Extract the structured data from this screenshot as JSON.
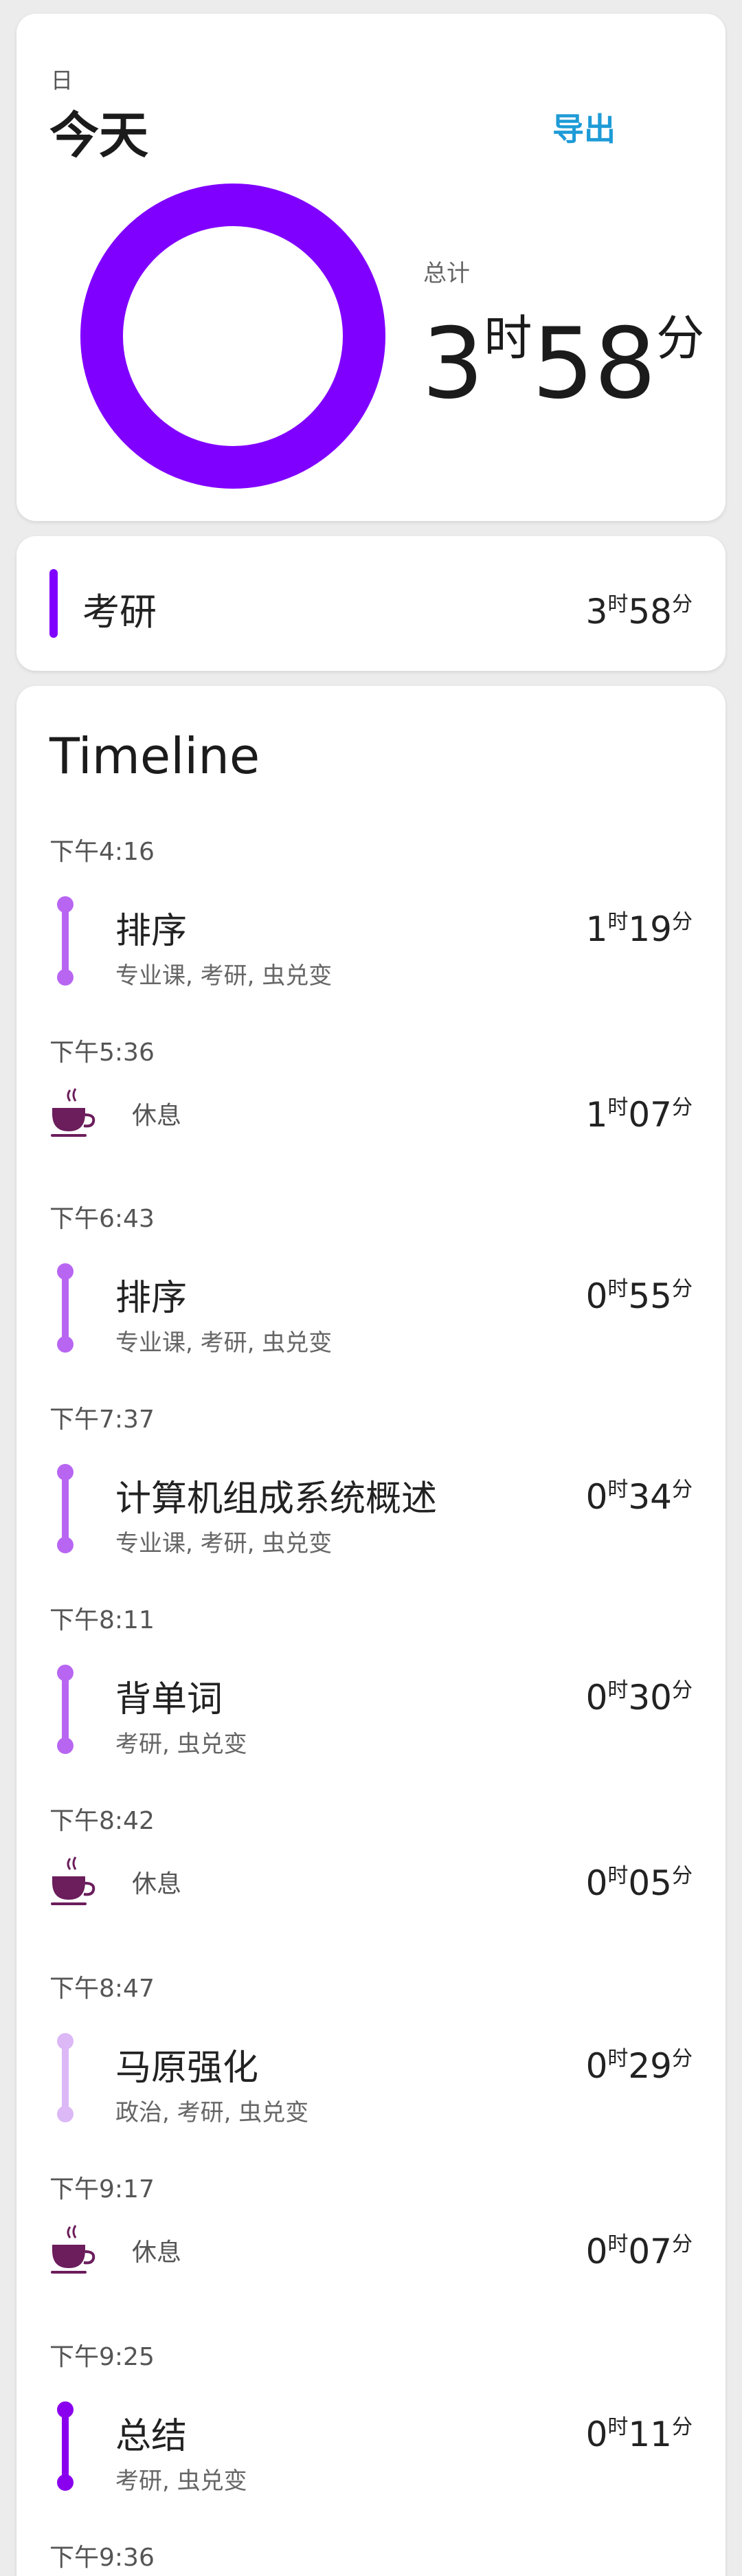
{
  "summary": {
    "period": "日",
    "title": "今天",
    "export_label": "导出",
    "total_label": "总计",
    "total_hours": "3",
    "hour_unit": "时",
    "total_minutes": "58",
    "minute_unit": "分",
    "donut_color": "#8000ff"
  },
  "category": {
    "name": "考研",
    "hours": "3",
    "hour_unit": "时",
    "minutes": "58",
    "minute_unit": "分",
    "color": "#8000ff"
  },
  "timeline": {
    "heading": "Timeline",
    "hour_unit": "时",
    "minute_unit": "分",
    "break_color": "#6b1d5c",
    "items": [
      {
        "time": "下午4:16",
        "kind": "task",
        "name": "排序",
        "tags": "专业课, 考研, 虫兑变",
        "hours": "1",
        "minutes": "19",
        "color": "#b866f2"
      },
      {
        "time": "下午5:36",
        "kind": "break",
        "name": "休息",
        "hours": "1",
        "minutes": "07"
      },
      {
        "time": "下午6:43",
        "kind": "task",
        "name": "排序",
        "tags": "专业课, 考研, 虫兑变",
        "hours": "0",
        "minutes": "55",
        "color": "#b866f2"
      },
      {
        "time": "下午7:37",
        "kind": "task",
        "name": "计算机组成系统概述",
        "tags": "专业课, 考研, 虫兑变",
        "hours": "0",
        "minutes": "34",
        "color": "#b866f2"
      },
      {
        "time": "下午8:11",
        "kind": "task",
        "name": "背单词",
        "tags": "考研, 虫兑变",
        "hours": "0",
        "minutes": "30",
        "color": "#b866f2"
      },
      {
        "time": "下午8:42",
        "kind": "break",
        "name": "休息",
        "hours": "0",
        "minutes": "05"
      },
      {
        "time": "下午8:47",
        "kind": "task",
        "name": "马原强化",
        "tags": "政治, 考研, 虫兑变",
        "hours": "0",
        "minutes": "29",
        "color": "#dcb8f6"
      },
      {
        "time": "下午9:17",
        "kind": "break",
        "name": "休息",
        "hours": "0",
        "minutes": "07"
      },
      {
        "time": "下午9:25",
        "kind": "task",
        "name": "总结",
        "tags": "考研, 虫兑变",
        "hours": "0",
        "minutes": "11",
        "color": "#8a00ee"
      },
      {
        "time": "下午9:36"
      }
    ]
  }
}
